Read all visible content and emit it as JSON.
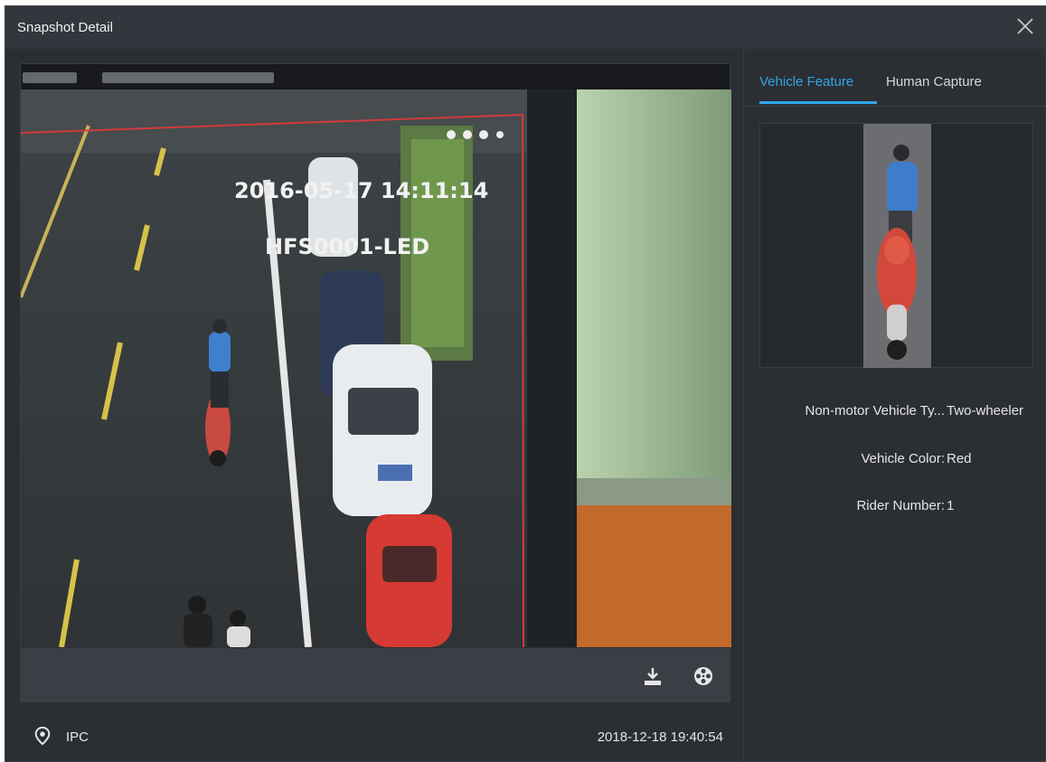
{
  "dialog": {
    "title": "Snapshot Detail",
    "close_icon": "close-icon"
  },
  "video": {
    "overlay_timestamp": "2016-05-17 14:11:14",
    "overlay_caption": "HFS0001-LED",
    "toolbar": {
      "download_icon": "download-icon",
      "film_reel_icon": "film-reel-icon"
    }
  },
  "footer": {
    "location_icon": "location-pin-icon",
    "device": "IPC",
    "timestamp": "2018-12-18 19:40:54"
  },
  "tabs": [
    {
      "label": "Vehicle Feature",
      "active": true
    },
    {
      "label": "Human Capture",
      "active": false
    }
  ],
  "attributes": [
    {
      "label": "Non-motor Vehicle Ty...",
      "value": "Two-wheeler"
    },
    {
      "label": "Vehicle Color:",
      "value": "Red"
    },
    {
      "label": "Rider Number:",
      "value": "1"
    }
  ],
  "colors": {
    "accent": "#2fa7e8",
    "background": "#2b2e33",
    "titlebar": "#33373d"
  }
}
